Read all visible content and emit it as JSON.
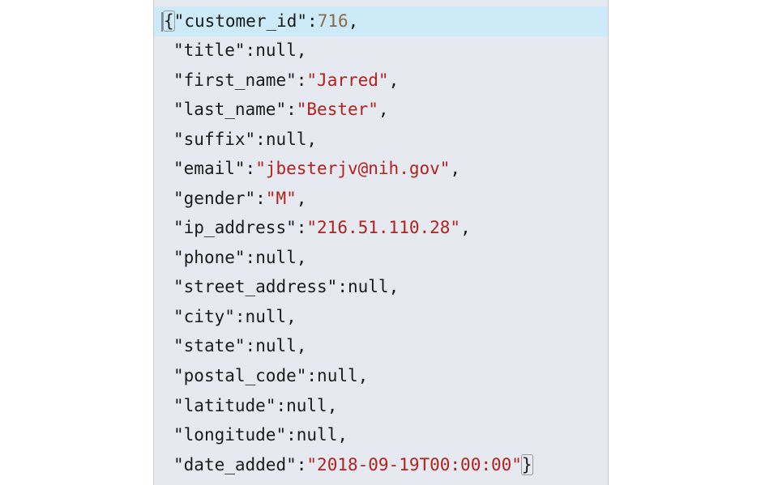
{
  "editor": {
    "lines": [
      {
        "key": "customer_id",
        "type": "number",
        "value": "716",
        "open_brace": true
      },
      {
        "key": "title",
        "type": "null",
        "value": "null"
      },
      {
        "key": "first_name",
        "type": "string",
        "value": "\"Jarred\""
      },
      {
        "key": "last_name",
        "type": "string",
        "value": "\"Bester\""
      },
      {
        "key": "suffix",
        "type": "null",
        "value": "null"
      },
      {
        "key": "email",
        "type": "string",
        "value": "\"jbesterjv@nih.gov\""
      },
      {
        "key": "gender",
        "type": "string",
        "value": "\"M\""
      },
      {
        "key": "ip_address",
        "type": "string",
        "value": "\"216.51.110.28\""
      },
      {
        "key": "phone",
        "type": "null",
        "value": "null"
      },
      {
        "key": "street_address",
        "type": "null",
        "value": "null"
      },
      {
        "key": "city",
        "type": "null",
        "value": "null"
      },
      {
        "key": "state",
        "type": "null",
        "value": "null"
      },
      {
        "key": "postal_code",
        "type": "null",
        "value": "null"
      },
      {
        "key": "latitude",
        "type": "null",
        "value": "null"
      },
      {
        "key": "longitude",
        "type": "null",
        "value": "null"
      },
      {
        "key": "date_added",
        "type": "string",
        "value": "\"2018-09-19T00:00:00\"",
        "close_brace": true
      }
    ]
  }
}
